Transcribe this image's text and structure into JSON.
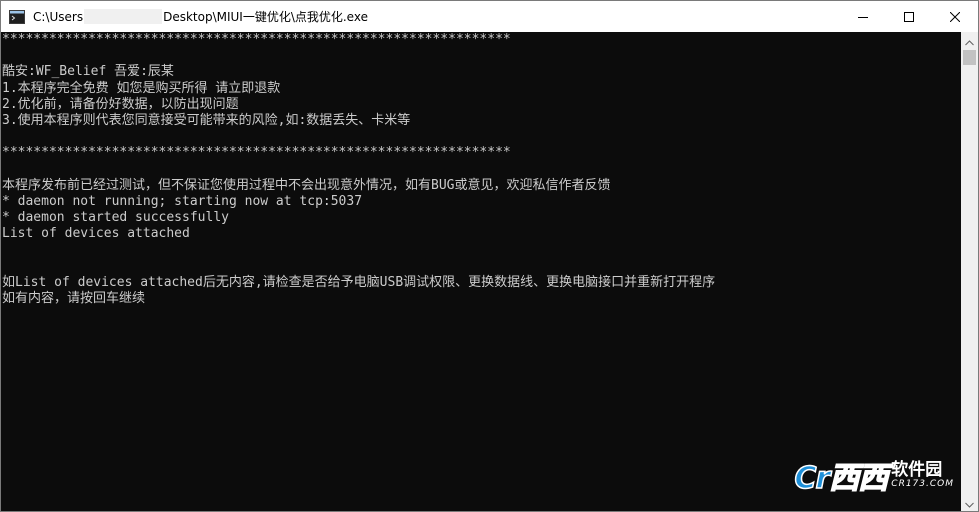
{
  "window": {
    "title_prefix": "C:\\Users",
    "title_suffix": "Desktop\\MIUI一键优化\\点我优化.exe"
  },
  "console": {
    "lines": [
      "*****************************************************************",
      "",
      "酷安:WF_Belief 吾爱:辰某",
      "1.本程序完全免费 如您是购买所得 请立即退款",
      "2.优化前，请备份好数据，以防出现问题",
      "3.使用本程序则代表您同意接受可能带来的风险,如:数据丢失、卡米等",
      "",
      "*****************************************************************",
      "",
      "本程序发布前已经过测试，但不保证您使用过程中不会出现意外情况，如有BUG或意见，欢迎私信作者反馈",
      "* daemon not running; starting now at tcp:5037",
      "* daemon started successfully",
      "List of devices attached",
      "",
      "",
      "如List of devices attached后无内容,请检查是否给予电脑USB调试权限、更换数据线、更换电脑接口并重新打开程序",
      "如有内容，请按回车继续"
    ]
  },
  "watermark": {
    "logo_text": "Cr",
    "logo_red": "西西",
    "brand": "软件园",
    "url": "CR173.COM"
  },
  "icons": {
    "app": "console-app-icon",
    "minimize": "minimize-icon",
    "maximize": "maximize-icon",
    "close": "close-icon"
  }
}
